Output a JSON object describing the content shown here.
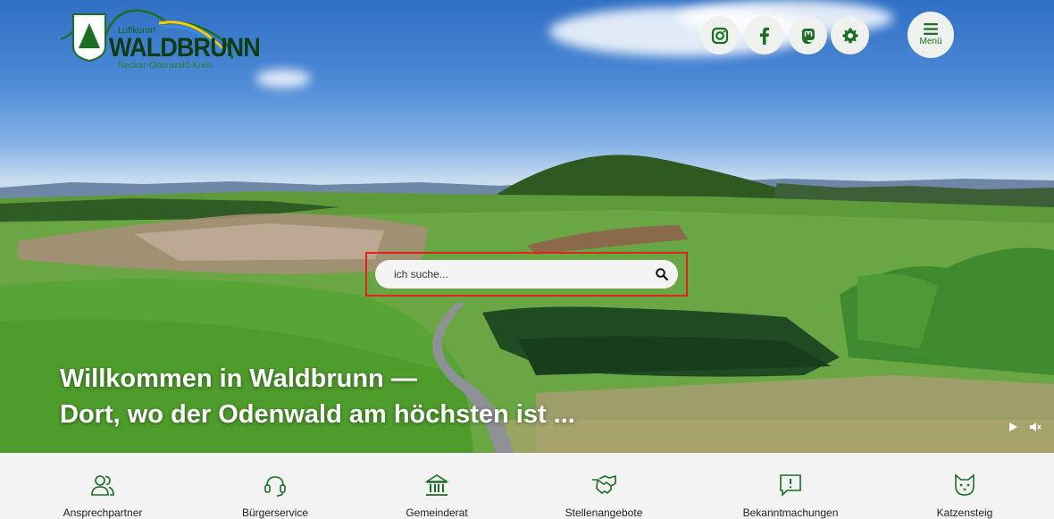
{
  "logo": {
    "small": "Luftkurort",
    "name": "WALDBRUNN",
    "sub": "Neckar-Odenwald-Kreis"
  },
  "header": {
    "social": [
      {
        "icon": "instagram-icon"
      },
      {
        "icon": "facebook-icon"
      },
      {
        "icon": "mastodon-icon"
      },
      {
        "icon": "gear-icon"
      }
    ],
    "menu_label": "Menü"
  },
  "search": {
    "placeholder": "ich suche..."
  },
  "hero": {
    "line1": "Willkommen in Waldbrunn —",
    "line2": "Dort, wo der Odenwald am höchsten ist ..."
  },
  "quicknav": [
    {
      "label": "Ansprechpartner",
      "icon": "people-icon"
    },
    {
      "label": "Bürgerservice",
      "icon": "headset-icon"
    },
    {
      "label": "Gemeinderat",
      "icon": "town-hall-icon"
    },
    {
      "label": "Stellenangebote",
      "icon": "handshake-icon"
    },
    {
      "label": "Bekanntmachungen",
      "icon": "announcement-icon"
    },
    {
      "label": "Katzensteig",
      "icon": "cat-icon"
    }
  ],
  "colors": {
    "brand_green": "#1b6e24",
    "highlight": "#e0241c"
  }
}
